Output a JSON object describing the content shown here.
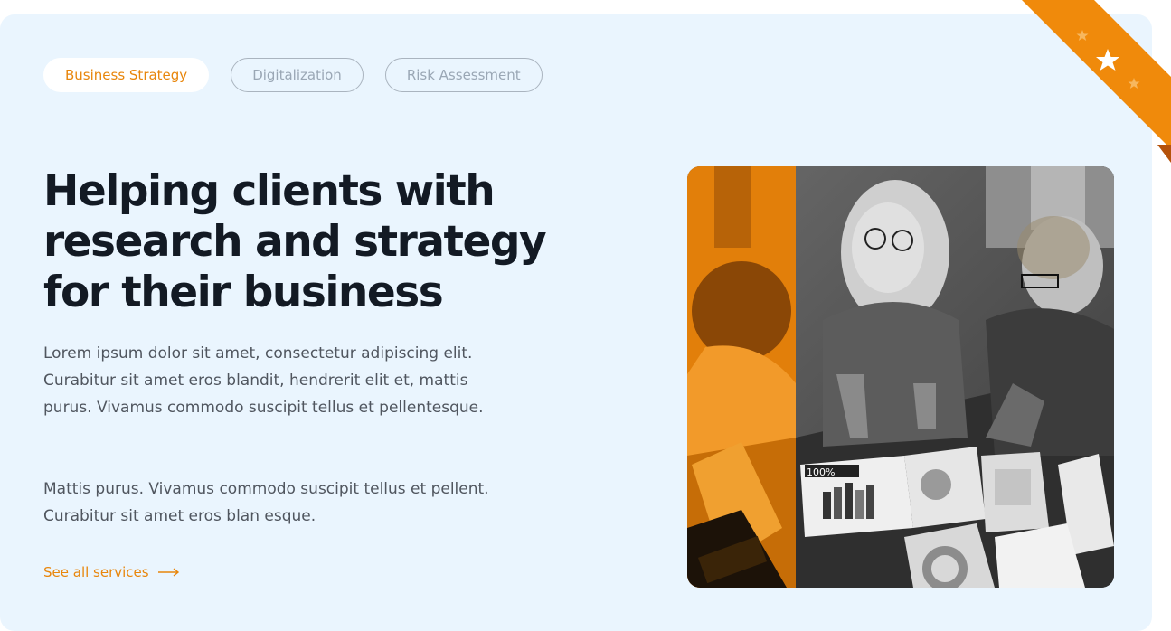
{
  "tabs": [
    {
      "label": "Business Strategy",
      "active": true
    },
    {
      "label": "Digitalization",
      "active": false
    },
    {
      "label": "Risk Assessment",
      "active": false
    }
  ],
  "hero": {
    "headline_line1": "Helping clients with",
    "headline_line2": "research and strategy",
    "headline_line3": "for their business",
    "paragraph1": "Lorem ipsum dolor sit amet, consectetur adipiscing elit. Curabitur sit amet eros blandit, hendrerit elit et, mattis purus. Vivamus commodo suscipit tellus et pellentesque.",
    "paragraph2": "Mattis purus. Vivamus commodo suscipit tellus et pellent. Curabitur sit amet eros blan esque.",
    "link_label": "See all services"
  },
  "photo": {
    "chart_label": "100%"
  },
  "colors": {
    "accent": "#e8860c",
    "card_bg": "#eaf5fe",
    "heading": "#131a24",
    "body_text": "#50565f",
    "inactive_tab": "#9aa7b5",
    "ribbon": "#f08a0b"
  },
  "icons": {
    "link_arrow": "arrow-right-icon",
    "ribbon_stars": "star-icon"
  }
}
